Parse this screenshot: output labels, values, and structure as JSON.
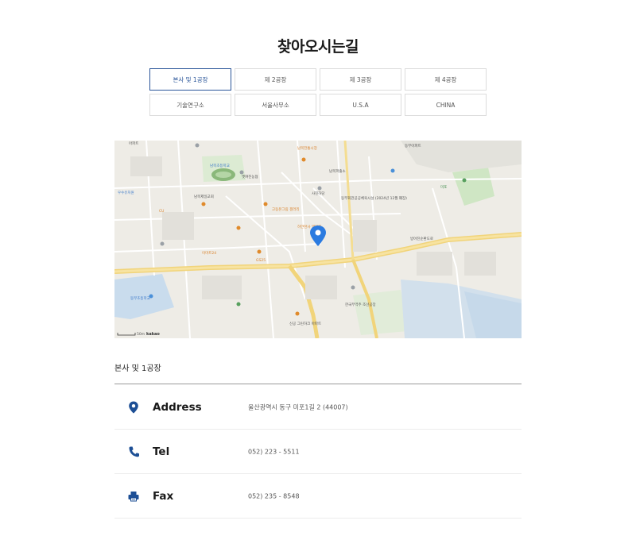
{
  "page": {
    "title": "찾아오시는길"
  },
  "tabs": [
    {
      "label": "본사 및 1공장",
      "active": true
    },
    {
      "label": "제 2공장"
    },
    {
      "label": "제 3공장"
    },
    {
      "label": "제 4공장"
    },
    {
      "label": "기술연구소"
    },
    {
      "label": "서울사무소"
    },
    {
      "label": "U.S.A"
    },
    {
      "label": "CHINA"
    }
  ],
  "map": {
    "scale_label": "50m",
    "brand": "kakao",
    "places": [
      "아파트",
      "남목초등학교",
      "옛여진농협",
      "남목전통시장",
      "남목파출소",
      "사진하당",
      "동부회관공공체육시설 (2024년 12월 폐장)",
      "고동본그림 갤러리",
      "하얀천사 영업지",
      "방어진순환도로",
      "한국무역주 조선공장",
      "신공 그린하크 아파트",
      "동부아파트",
      "우수유치원",
      "이마트24",
      "GS25",
      "CU",
      "동부초등학교",
      "남목제일교회",
      "미포"
    ]
  },
  "section": {
    "title": "본사 및 1공장"
  },
  "info": {
    "address": {
      "label": "Address",
      "value": "울산광역시 동구 미포1길 2 (44007)",
      "icon": "map-pin-icon"
    },
    "tel": {
      "label": "Tel",
      "value": "052) 223 - 5511",
      "icon": "phone-icon"
    },
    "fax": {
      "label": "Fax",
      "value": "052) 235 - 8548",
      "icon": "printer-icon"
    }
  },
  "colors": {
    "accent": "#2a5599",
    "icon": "#1d4f95",
    "marker": "#2b7be0"
  }
}
